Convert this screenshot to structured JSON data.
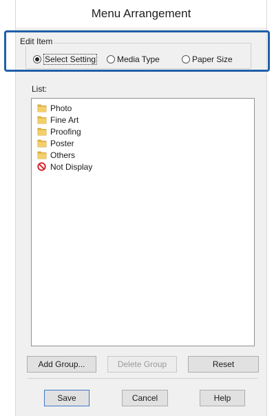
{
  "dialog": {
    "title": "Menu Arrangement"
  },
  "edit_item": {
    "group_label": "Edit Item",
    "options": [
      {
        "label": "Select Setting",
        "checked": true
      },
      {
        "label": "Media Type",
        "checked": false
      },
      {
        "label": "Paper Size",
        "checked": false
      }
    ]
  },
  "list": {
    "label": "List:",
    "items": [
      {
        "label": "Photo",
        "icon": "folder-icon"
      },
      {
        "label": "Fine Art",
        "icon": "folder-icon"
      },
      {
        "label": "Proofing",
        "icon": "folder-icon"
      },
      {
        "label": "Poster",
        "icon": "folder-icon"
      },
      {
        "label": "Others",
        "icon": "folder-icon"
      },
      {
        "label": "Not Display",
        "icon": "no-entry-icon"
      }
    ]
  },
  "buttons": {
    "add_group": "Add Group...",
    "delete_group": "Delete Group",
    "reset": "Reset",
    "save": "Save",
    "cancel": "Cancel",
    "help": "Help"
  },
  "colors": {
    "highlight": "#1f5fa8",
    "folder": "#e8b53a",
    "no_entry": "#d8252b"
  }
}
